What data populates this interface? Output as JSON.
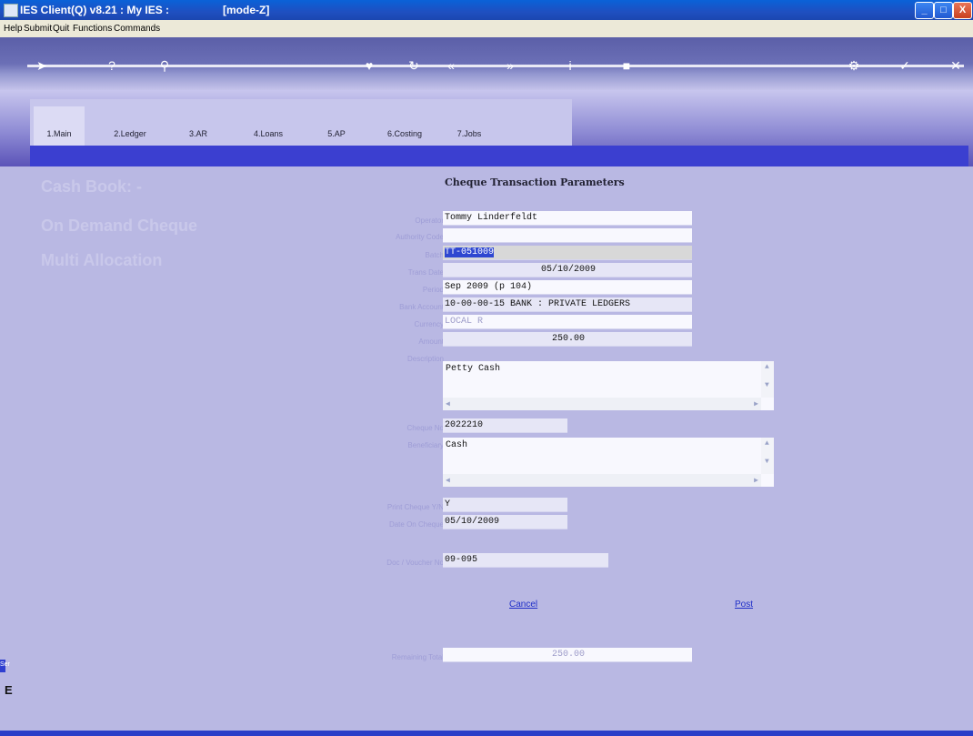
{
  "window": {
    "title": "IES Client(Q) v8.21 : My IES :",
    "mode": "[mode-Z]",
    "minimize_glyph": "_",
    "maximize_glyph": "□",
    "close_glyph": "X"
  },
  "menu": [
    "Help",
    "Submit",
    "Quit",
    "Functions",
    "Commands"
  ],
  "toolbar": {
    "icons": [
      "pointer-icon",
      "help-icon",
      "search-icon",
      "favorite-icon",
      "refresh-icon",
      "rewind-icon",
      "forward-icon",
      "info-icon",
      "stop-icon",
      "settings-icon",
      "ok-icon",
      "close-icon"
    ],
    "glyphs": {
      "pointer": "➤",
      "help": "?",
      "search": "⚲",
      "favorite": "♥",
      "refresh": "↻",
      "rewind": "«",
      "forward": "»",
      "info": "i",
      "stop": "■",
      "settings": "⚙",
      "ok": "✓",
      "close": "✕"
    }
  },
  "tabs": [
    "1.Main",
    "2.Ledger",
    "3.AR",
    "4.Loans",
    "5.AP",
    "6.Costing",
    "7.Jobs"
  ],
  "left_titles": {
    "cash_book": "Cash Book: -",
    "on_demand": "On Demand Cheque",
    "multi": "Multi Allocation"
  },
  "form": {
    "title": "Cheque Transaction Parameters",
    "labels": {
      "operator": "Operator",
      "authority_code": "Authority Code",
      "batch": "Batch",
      "trans_date": "Trans Date",
      "period": "Period",
      "bank_account": "Bank Account",
      "currency": "Currency",
      "amount": "Amount",
      "description": "Description",
      "cheque_no": "Cheque No",
      "beneficiary": "Beneficiary",
      "print_cheque": "Print Cheque Y/N",
      "date_on_cheque": "Date On Cheque",
      "doc_voucher": "Doc / Voucher No",
      "remaining_total": "Remaining Total"
    },
    "values": {
      "operator": "Tommy Linderfeldt",
      "authority_code": "",
      "batch": "TT-051009",
      "trans_date": "05/10/2009",
      "period": "Sep 2009 (p 104)",
      "bank_account": "10-00-00-15 BANK : PRIVATE LEDGERS",
      "currency": "LOCAL R",
      "amount": "250.00",
      "description": "Petty Cash",
      "cheque_no": "2022210",
      "beneficiary": "Cash",
      "print_cheque": "Y",
      "date_on_cheque": "05/10/2009",
      "doc_voucher": "09-095",
      "remaining_total": "250.00"
    },
    "cancel": "Cancel",
    "post": "Post"
  },
  "side": {
    "label": "Ser",
    "marker": "E"
  }
}
